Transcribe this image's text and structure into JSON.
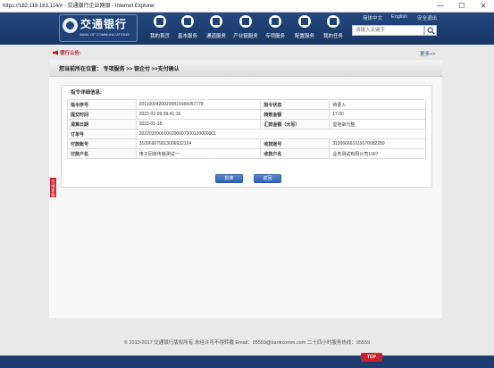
{
  "window": {
    "title": "https://182.119.163.114/# - 交通银行企业网银 - Internet Explorer",
    "minimize": "—",
    "maximize": "☐",
    "close": "✕"
  },
  "header": {
    "logo_cn": "交通银行",
    "logo_en": "BANK OF COMMUNICATIONS",
    "nav": [
      {
        "label": "我的首页",
        "icon": "home-icon"
      },
      {
        "label": "基本服务",
        "icon": "basic-service-icon"
      },
      {
        "label": "通道服务",
        "icon": "channel-icon"
      },
      {
        "label": "产业链服务",
        "icon": "chain-icon"
      },
      {
        "label": "专项服务",
        "icon": "tools-icon"
      },
      {
        "label": "配置服务",
        "icon": "config-icon"
      },
      {
        "label": "我的任务",
        "icon": "tasks-icon"
      }
    ],
    "toplinks": {
      "lang_cn": "简体中文",
      "lang_en": "English",
      "logout": "安全退出"
    },
    "search": {
      "placeholder": "请输入关键字"
    }
  },
  "notice": {
    "label": "银行公告:",
    "more": "更多>>"
  },
  "breadcrumb": "您当前所在位置：  专项服务   >>   银企付   >>支付确认",
  "detail": {
    "title": "指令详细信息:",
    "rows": [
      {
        "l1": "指令序号",
        "v1": "20110004200200819184057778",
        "l2": "指令状态",
        "v2": "待录入"
      },
      {
        "l1": "提交时间",
        "v1": "2022-02-09 09:41:16",
        "l2": "转账金额",
        "v2": "17.00"
      },
      {
        "l1": "清算日期",
        "v1": "2022-01-18",
        "l2": "汇款金额（大写）",
        "v2": "壹拾柒元整"
      },
      {
        "l1": "订单号",
        "v1": "2022020900100200007300120000001",
        "l2": "",
        "v2": ""
      },
      {
        "l1": "付款账号",
        "v1": "310069079013006932124",
        "l2": "收款账号",
        "v2": "310066661019170082289"
      },
      {
        "l1": "付款户名",
        "v1": "电子回单传输测试一",
        "l2": "收款户名",
        "v2": "业务测试有限公司1007"
      }
    ],
    "confirm": "批准",
    "back": "返回"
  },
  "side_tab": "在线客服",
  "footer": "© 2013-2017 交通银行版权所有 未经许可不得转载 Email：95559@bankcomm.com 二十四小时服务热线：95559",
  "top_button": "TOP"
}
